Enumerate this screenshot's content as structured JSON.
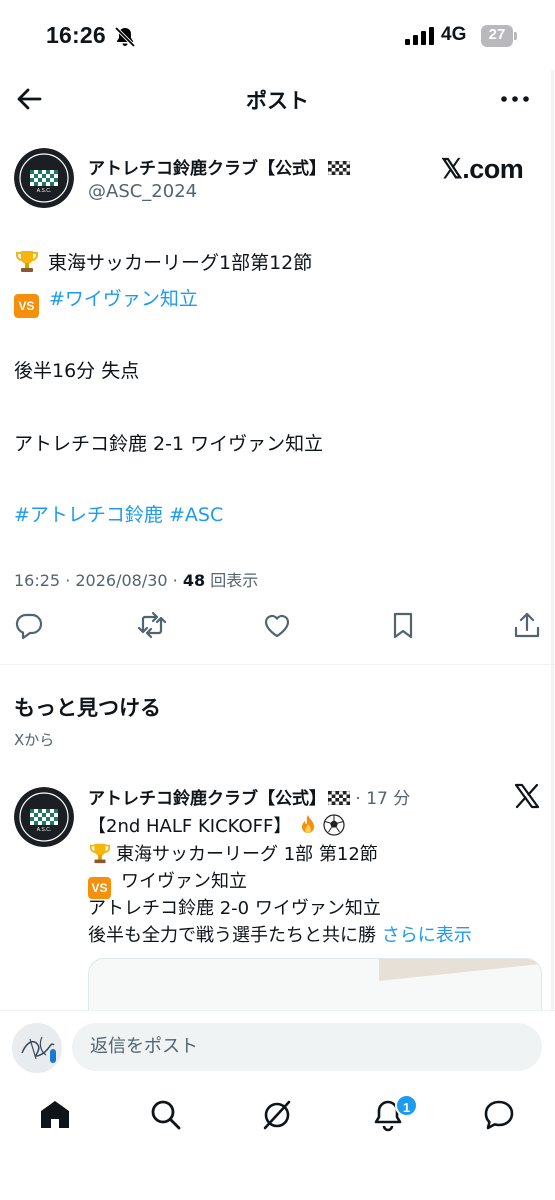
{
  "status_bar": {
    "time": "16:26",
    "network": "4G",
    "battery": "27"
  },
  "header": {
    "title": "ポスト"
  },
  "post": {
    "author_name": "アトレチコ鈴鹿クラブ【公式】",
    "author_handle": "@ASC_2024",
    "source_logo": "𝕏.com",
    "line_league": "東海サッカーリーグ1部第12節",
    "line_opponent": "#ワイヴァン知立",
    "line_event": "後半16分  失点",
    "line_score": "アトレチコ鈴鹿 2-1 ワイヴァン知立",
    "hashtags": "#アトレチコ鈴鹿 #ASC",
    "meta_time": "16:25 · 2026/08/30 · ",
    "meta_views": "48",
    "meta_views_label": " 回表示",
    "icons": [
      "reply-icon",
      "repost-icon",
      "like-icon",
      "bookmark-icon",
      "share-icon"
    ]
  },
  "discover": {
    "title": "もっと見つける",
    "subtitle": "Xから"
  },
  "related_post": {
    "author_name": "アトレチコ鈴鹿クラブ【公式】",
    "time": " · 17 分",
    "line1": "【2nd HALF KICKOFF】 ",
    "line2": "東海サッカーリーグ 1部 第12節",
    "line3": "ワイヴァン知立",
    "line4": "アトレチコ鈴鹿 2-0 ワイヴァン知立",
    "line5": "後半も全力で戦う選手たちと共に勝 ",
    "more_link": "さらに表示"
  },
  "reply": {
    "placeholder": "返信をポスト"
  },
  "bottom_nav": {
    "items": [
      "home-icon",
      "search-icon",
      "grok-icon",
      "notifications-icon",
      "messages-icon"
    ],
    "notification_badge": "1"
  },
  "colors": {
    "link": "#1d9bf0",
    "secondary_text": "#536471",
    "primary_text": "#0f1419"
  }
}
